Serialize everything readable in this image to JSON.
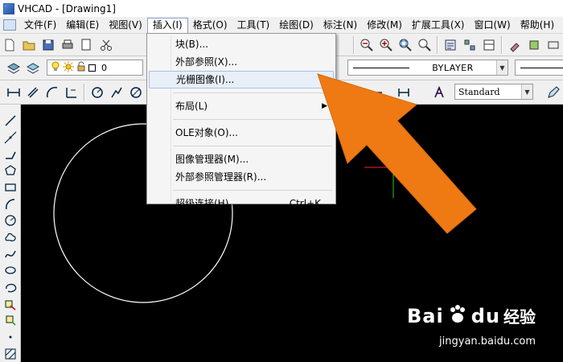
{
  "window": {
    "title": "VHCAD - [Drawing1]"
  },
  "menubar": {
    "items": [
      {
        "label": "文件(F)"
      },
      {
        "label": "编辑(E)"
      },
      {
        "label": "视图(V)"
      },
      {
        "label": "插入(I)"
      },
      {
        "label": "格式(O)"
      },
      {
        "label": "工具(T)"
      },
      {
        "label": "绘图(D)"
      },
      {
        "label": "标注(N)"
      },
      {
        "label": "修改(M)"
      },
      {
        "label": "扩展工具(X)"
      },
      {
        "label": "窗口(W)"
      },
      {
        "label": "帮助(H)"
      }
    ]
  },
  "toolbar2": {
    "layer_name": "0",
    "linetype_label": "BYLAYER"
  },
  "toolbar3": {
    "text_style": "Standard"
  },
  "insert_menu": {
    "items": [
      {
        "label": "块(B)..."
      },
      {
        "label": "外部参照(X)..."
      },
      {
        "label": "光栅图像(I)..."
      },
      {
        "label": "布局(L)"
      },
      {
        "label": "OLE对象(O)..."
      },
      {
        "label": "图像管理器(M)..."
      },
      {
        "label": "外部参照管理器(R)..."
      },
      {
        "label": "超级连接(H)...",
        "shortcut": "Ctrl+K"
      }
    ]
  },
  "colors": {
    "accent_arrow": "#ef7a14",
    "canvas_bg": "#000000",
    "highlight_bg": "#e8eff8"
  },
  "watermark": {
    "logo": "Bai",
    "logo2": "du",
    "cn": "经验",
    "url": "jingyan.baidu.com"
  }
}
